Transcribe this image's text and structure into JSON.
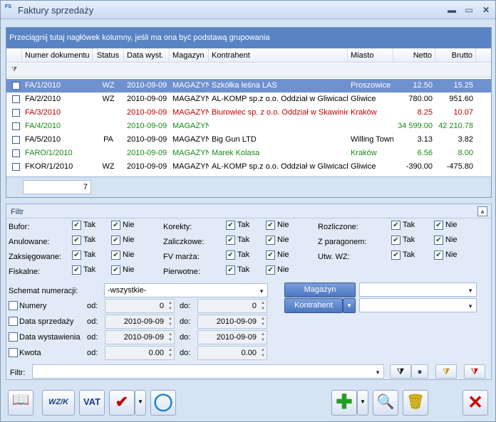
{
  "window": {
    "title": "Faktury sprzedaży",
    "icon_text": "FS"
  },
  "grid": {
    "group_hint": "Przeciągnij tutaj nagłówek kolumny, jeśli ma ona być podstawą grupowania",
    "columns": [
      "Numer dokumentu",
      "Status",
      "Data wyst.",
      "Magazyn",
      "Kontrahent",
      "Miasto",
      "Netto",
      "Brutto"
    ],
    "rows": [
      {
        "numer": "FA/1/2010",
        "status": "WZ",
        "data": "2010-09-09",
        "magazyn": "MAGAZYN",
        "kontrahent": "Szkółka leśna LAS",
        "miasto": "Proszowice",
        "netto": "12.50",
        "brutto": "15.25",
        "color": "selected"
      },
      {
        "numer": "FA/2/2010",
        "status": "WZ",
        "data": "2010-09-09",
        "magazyn": "MAGAZYN",
        "kontrahent": "AL-KOMP sp.z o.o. Oddział w Gliwicach",
        "miasto": "Gliwice",
        "netto": "780.00",
        "brutto": "951.60",
        "color": "black"
      },
      {
        "numer": "FA/3/2010",
        "status": "",
        "data": "2010-09-09",
        "magazyn": "MAGAZYN",
        "kontrahent": "Biurowiec sp. z o.o. Oddział w Skawinie",
        "miasto": "Kraków",
        "netto": "8.25",
        "brutto": "10.07",
        "color": "red"
      },
      {
        "numer": "FA/4/2010",
        "status": "",
        "data": "2010-09-09",
        "magazyn": "MAGAZYN",
        "kontrahent": "",
        "miasto": "",
        "netto": "34 599.00",
        "brutto": "42 210.78",
        "color": "green"
      },
      {
        "numer": "FA/5/2010",
        "status": "PA",
        "data": "2010-09-09",
        "magazyn": "MAGAZYN",
        "kontrahent": "Big Gun LTD",
        "miasto": "Willing Town",
        "netto": "3.13",
        "brutto": "3.82",
        "color": "black"
      },
      {
        "numer": "FARO/1/2010",
        "status": "",
        "data": "2010-09-09",
        "magazyn": "MAGAZYN",
        "kontrahent": "Marek Kolasa",
        "miasto": "Kraków",
        "netto": "6.56",
        "brutto": "8.00",
        "color": "green"
      },
      {
        "numer": "FKOR/1/2010",
        "status": "WZ",
        "data": "2010-09-09",
        "magazyn": "MAGAZYN",
        "kontrahent": "AL-KOMP sp.z o.o. Oddział w Gliwicach",
        "miasto": "Gliwice",
        "netto": "-390.00",
        "brutto": "-475.80",
        "color": "black"
      }
    ],
    "count": "7"
  },
  "filter": {
    "title": "Filtr",
    "tak": "Tak",
    "nie": "Nie",
    "groups": [
      {
        "label": "Bufor:"
      },
      {
        "label": "Anulowane:"
      },
      {
        "label": "Zaksięgowane:"
      },
      {
        "label": "Fiskalne:"
      },
      {
        "label": "Korekty:"
      },
      {
        "label": "Zaliczkowe:"
      },
      {
        "label": "FV marża:"
      },
      {
        "label": "Pierwotne:"
      },
      {
        "label": "Rozliczone:"
      },
      {
        "label": "Z paragonem:"
      },
      {
        "label": "Utw. WZ:"
      }
    ],
    "schemat_label": "Schemat numeracji:",
    "schemat_value": "-wszystkie-",
    "magazyn_button": "Magazyn",
    "kontrahent_button": "Kontrahent",
    "od": "od:",
    "do": "do:",
    "ranges": [
      {
        "label": "Numery",
        "from": "0",
        "to": "0"
      },
      {
        "label": "Data sprzedaży",
        "from": "2010-09-09",
        "to": "2010-09-09"
      },
      {
        "label": "Data wystawienia",
        "from": "2010-09-09",
        "to": "2010-09-09"
      },
      {
        "label": "Kwota",
        "from": "0.00",
        "to": "0.00"
      }
    ],
    "filtr_label": "Filtr:"
  },
  "toolbar": {
    "wzk_label": "WZ/K",
    "vat_label": "VAT"
  }
}
